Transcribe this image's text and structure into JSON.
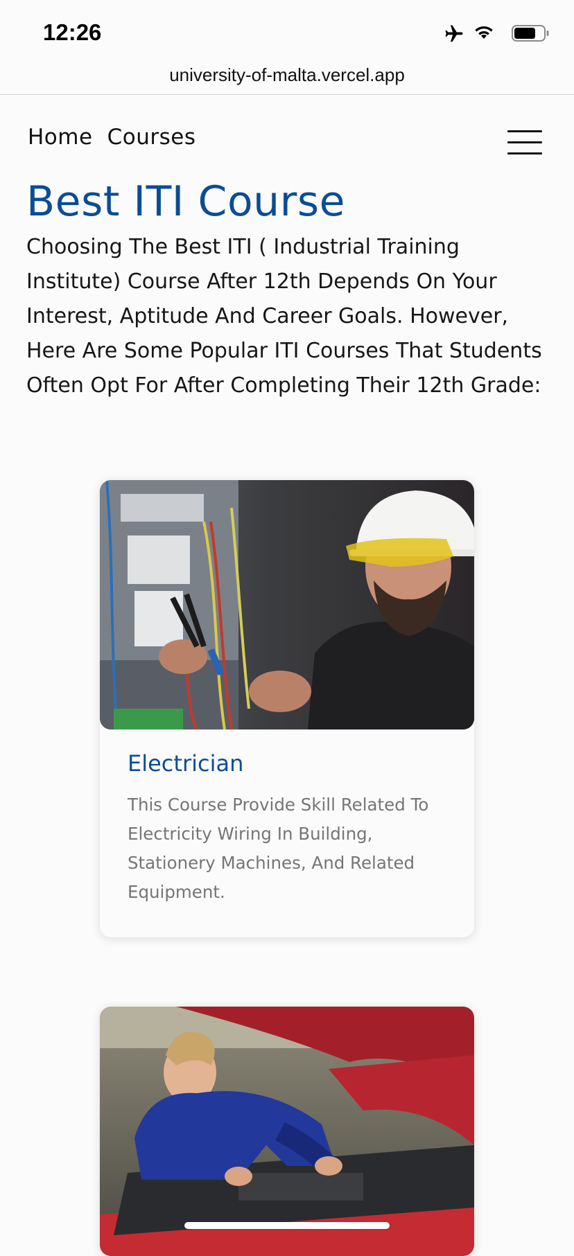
{
  "status_bar": {
    "time": "12:26",
    "icons": [
      "airplane-icon",
      "wifi-icon",
      "battery-icon"
    ]
  },
  "browser": {
    "url": "university-of-malta.vercel.app"
  },
  "nav": {
    "items": [
      {
        "label": "Home"
      },
      {
        "label": "Courses"
      }
    ],
    "menu_icon": "hamburger-menu-icon"
  },
  "page": {
    "title": "Best ITI Course",
    "intro": "Choosing The Best ITI ( Industrial Training Institute) Course After 12th Depends On Your Interest, Aptitude And Career Goals. However, Here Are Some Popular ITI Courses That Students Often Opt For After Completing Their 12th Grade:"
  },
  "courses": [
    {
      "title": "Electrician",
      "description": "This Course Provide Skill Related To Electricity Wiring In Building, Stationery Machines, And Related Equipment.",
      "image": "electrician-photo"
    },
    {
      "title": "",
      "description": "",
      "image": "mechanic-photo"
    }
  ],
  "colors": {
    "accent": "#0b4d94",
    "body_text": "#161616",
    "muted_text": "#757575",
    "background": "#fbfbfb"
  }
}
